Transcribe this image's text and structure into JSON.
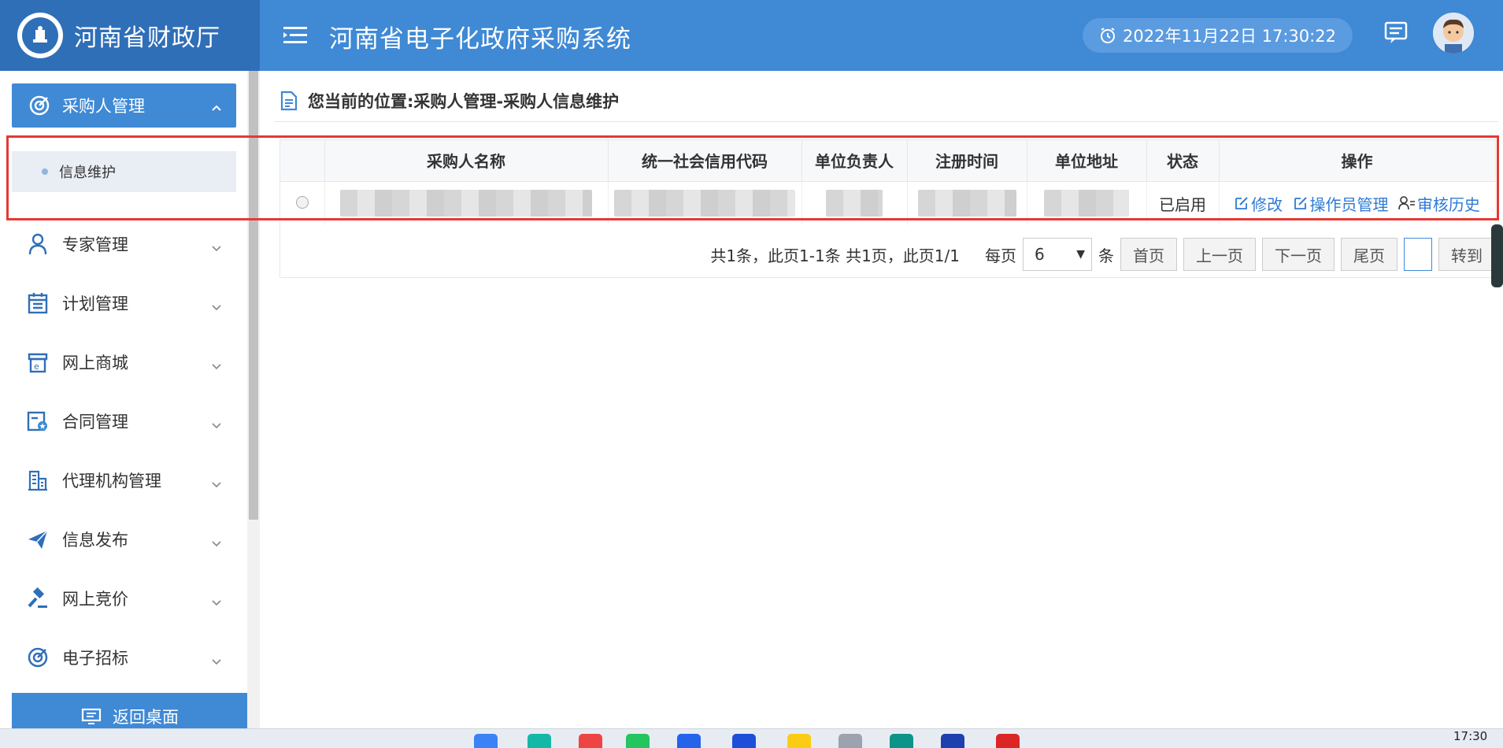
{
  "header": {
    "brand_title": "河南省财政厅",
    "system_title": "河南省电子化政府采购系统",
    "datetime": "2022年11月22日 17:30:22"
  },
  "sidebar": {
    "active_menu": {
      "label": "采购人管理",
      "icon": "target-icon"
    },
    "active_sub": {
      "label": "信息维护"
    },
    "items": [
      {
        "label": "专家管理",
        "icon": "person-icon"
      },
      {
        "label": "计划管理",
        "icon": "calendar-icon"
      },
      {
        "label": "网上商城",
        "icon": "store-icon"
      },
      {
        "label": "合同管理",
        "icon": "contract-icon"
      },
      {
        "label": "代理机构管理",
        "icon": "building-icon"
      },
      {
        "label": "信息发布",
        "icon": "paper-plane-icon"
      },
      {
        "label": "网上竞价",
        "icon": "gavel-icon"
      },
      {
        "label": "电子招标",
        "icon": "target-icon"
      }
    ],
    "back_desk": "返回桌面"
  },
  "main": {
    "breadcrumb": "您当前的位置:采购人管理-采购人信息维护",
    "table": {
      "columns": [
        "",
        "采购人名称",
        "统一社会信用代码",
        "单位负责人",
        "注册时间",
        "单位地址",
        "状态",
        "操作"
      ],
      "rows": [
        {
          "status": "已启用",
          "ops": [
            "修改",
            "操作员管理",
            "审核历史"
          ]
        }
      ]
    },
    "pager": {
      "summary": "共1条，此页1-1条 共1页，此页1/1",
      "per_page_label": "每页",
      "per_page_value": "6",
      "unit": "条",
      "first": "首页",
      "prev": "上一页",
      "next": "下一页",
      "last": "尾页",
      "goto": "转到"
    }
  },
  "taskbar": {
    "time": "17:30"
  },
  "colors": {
    "primary": "#3f89d5",
    "brand_bg": "#2f6fb8",
    "link": "#2e7bd6",
    "highlight": "#e53935"
  }
}
